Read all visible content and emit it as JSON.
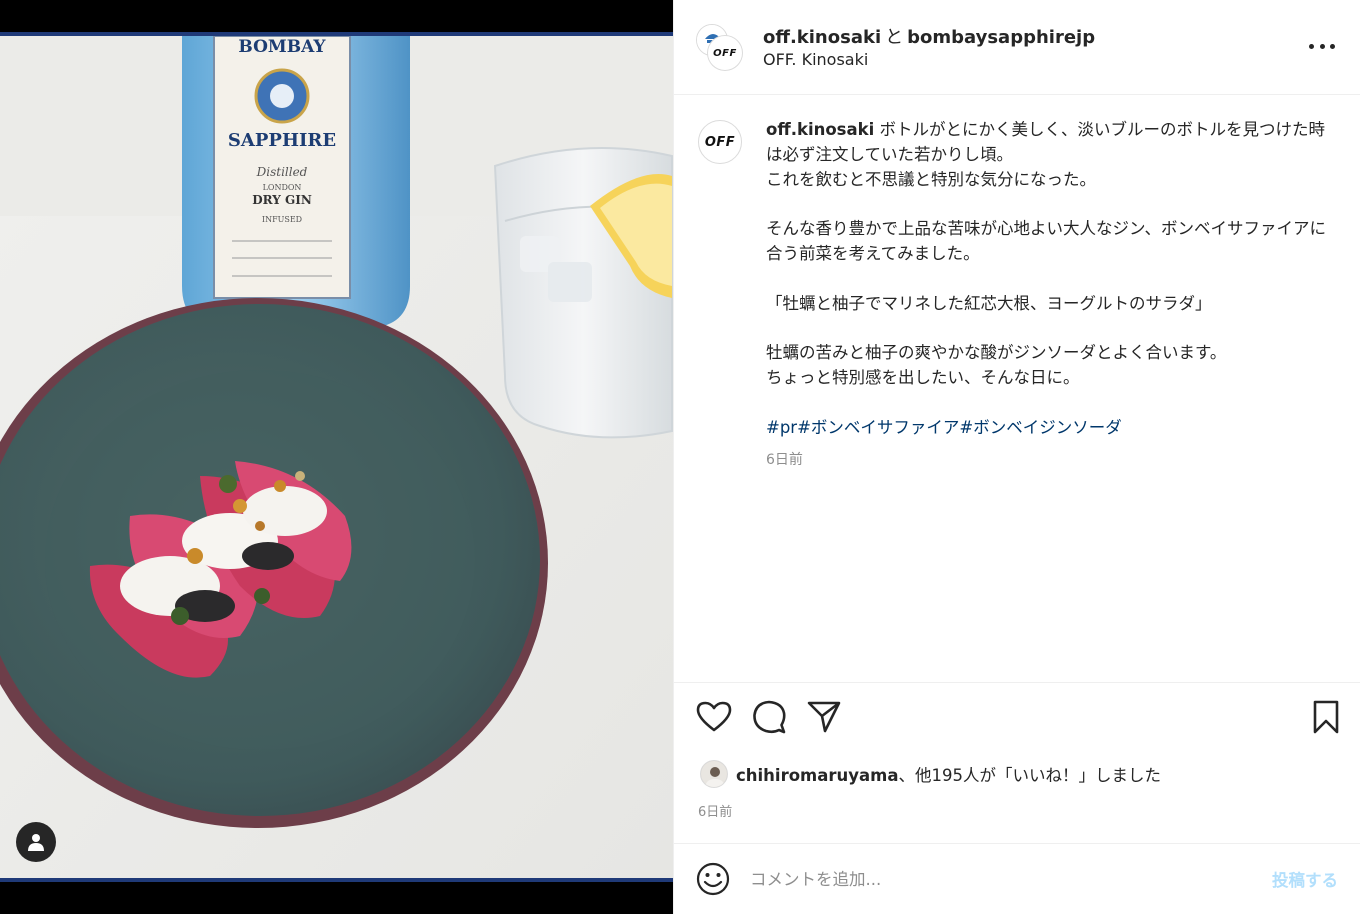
{
  "header": {
    "owner": "off.kinosaki",
    "and": "と",
    "collaborator": "bombaysapphirejp",
    "location": "OFF. Kinosaki",
    "avatar_text": "OFF"
  },
  "bottle_label": {
    "brand_top": "BOMBAY",
    "brand": "SAPPHIRE",
    "line1": "Distilled",
    "line2": "LONDON",
    "line3": "DRY GIN",
    "line4": "INFUSED"
  },
  "caption": {
    "avatar_text": "OFF",
    "user": "off.kinosaki",
    "first_line": " ボトルがとにかく美しく、淡いブルーのボトルを見つけた時は必ず注文していた若かりし頃。",
    "lines": [
      "これを飲むと不思議と特別な気分になった。",
      "",
      "そんな香り豊かで上品な苦味が心地よい大人なジン、ボンベイサファイアに合う前菜を考えてみました。",
      "",
      "「牡蠣と柚子でマリネした紅芯大根、ヨーグルトのサラダ」",
      "",
      "牡蠣の苦みと柚子の爽やかな酸がジンソーダとよく合います。",
      "ちょっと特別感を出したい、そんな日に。",
      ""
    ],
    "hashtags": [
      "#pr",
      "#ボンベイサファイア",
      "#ボンベイジンソーダ"
    ],
    "time": "6日前"
  },
  "likes": {
    "user": "chihiromaruyama",
    "rest": "、他195人が「いいね！」しました"
  },
  "post_time": "6日前",
  "comment": {
    "placeholder": "コメントを追加...",
    "post_label": "投稿する"
  },
  "colors": {
    "hashtag": "#00376b",
    "post_button": "#b2dffc",
    "media_edge": "#1f3a78"
  }
}
